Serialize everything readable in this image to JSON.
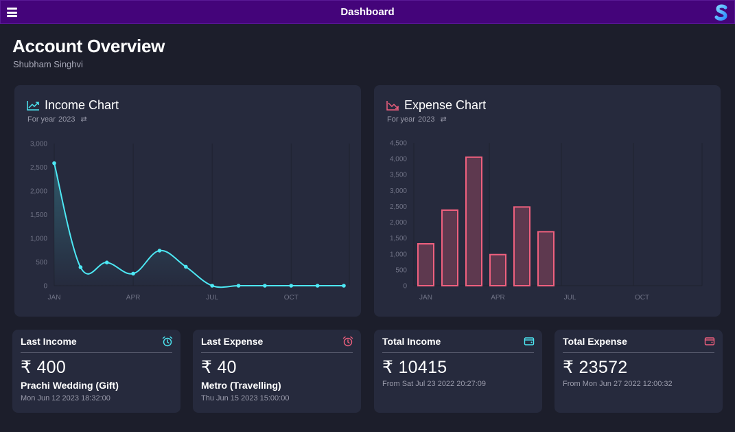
{
  "topbar": {
    "title": "Dashboard",
    "menu_icon": "hamburger-menu-icon",
    "logo_icon": "dollar-logo-icon"
  },
  "header": {
    "title": "Account Overview",
    "user_name": "Shubham Singhvi"
  },
  "colors": {
    "topbar": "#44047a",
    "background": "#1c1e2b",
    "card": "#262a3d",
    "income_accent": "#4de8f4",
    "expense_accent": "#f0607e"
  },
  "income_chart": {
    "title": "Income Chart",
    "year_label": "For year",
    "year": "2023",
    "icon": "trending-up-icon",
    "swap_icon": "swap-icon"
  },
  "expense_chart": {
    "title": "Expense Chart",
    "year_label": "For year",
    "year": "2023",
    "icon": "trending-down-icon",
    "swap_icon": "swap-icon"
  },
  "chart_data": [
    {
      "type": "line",
      "title": "",
      "x": [
        "JAN",
        "FEB",
        "MAR",
        "APR",
        "MAY",
        "JUN",
        "JUL",
        "AUG",
        "SEP",
        "OCT",
        "NOV",
        "DEC"
      ],
      "x_tick_labels": [
        "JAN",
        "APR",
        "JUL",
        "OCT"
      ],
      "series": [
        {
          "values": [
            2585,
            390,
            490,
            255,
            740,
            400,
            0,
            0,
            0,
            0,
            0,
            0
          ]
        }
      ],
      "ylim": [
        0,
        3000
      ],
      "y_ticks": [
        "0",
        "500",
        "1,000",
        "1,500",
        "2,000",
        "2,500",
        "3,000"
      ],
      "color": "#4de8f4",
      "xlabel": "",
      "ylabel": ""
    },
    {
      "type": "bar",
      "title": "",
      "categories": [
        "JAN",
        "FEB",
        "MAR",
        "APR",
        "MAY",
        "JUN",
        "JUL",
        "AUG",
        "SEP",
        "OCT",
        "NOV",
        "DEC"
      ],
      "x_tick_labels": [
        "JAN",
        "APR",
        "JUL",
        "OCT"
      ],
      "values": [
        1320,
        2380,
        4050,
        980,
        2480,
        1700,
        0,
        0,
        0,
        0,
        0,
        0
      ],
      "ylim": [
        0,
        4500
      ],
      "y_ticks": [
        "0",
        "500",
        "1,000",
        "1,500",
        "2,000",
        "2,500",
        "3,000",
        "3,500",
        "4,000",
        "4,500"
      ],
      "color": "#f0607e",
      "xlabel": "",
      "ylabel": ""
    }
  ],
  "stats": [
    {
      "title": "Last Income",
      "icon": "alarm-clock-icon",
      "icon_color": "#4de8f4",
      "value": "₹ 400",
      "description": "Prachi Wedding (Gift)",
      "date": "Mon Jun 12 2023 18:32:00"
    },
    {
      "title": "Last Expense",
      "icon": "alarm-clock-icon",
      "icon_color": "#f0607e",
      "value": "₹ 40",
      "description": "Metro (Travelling)",
      "date": "Thu Jun 15 2023 15:00:00"
    },
    {
      "title": "Total Income",
      "icon": "wallet-icon",
      "icon_color": "#4de8f4",
      "value": "₹ 10415",
      "date": "From Sat Jul 23 2022 20:27:09"
    },
    {
      "title": "Total Expense",
      "icon": "wallet-icon",
      "icon_color": "#f0607e",
      "value": "₹ 23572",
      "date": "From Mon Jun 27 2022 12:00:32"
    }
  ]
}
